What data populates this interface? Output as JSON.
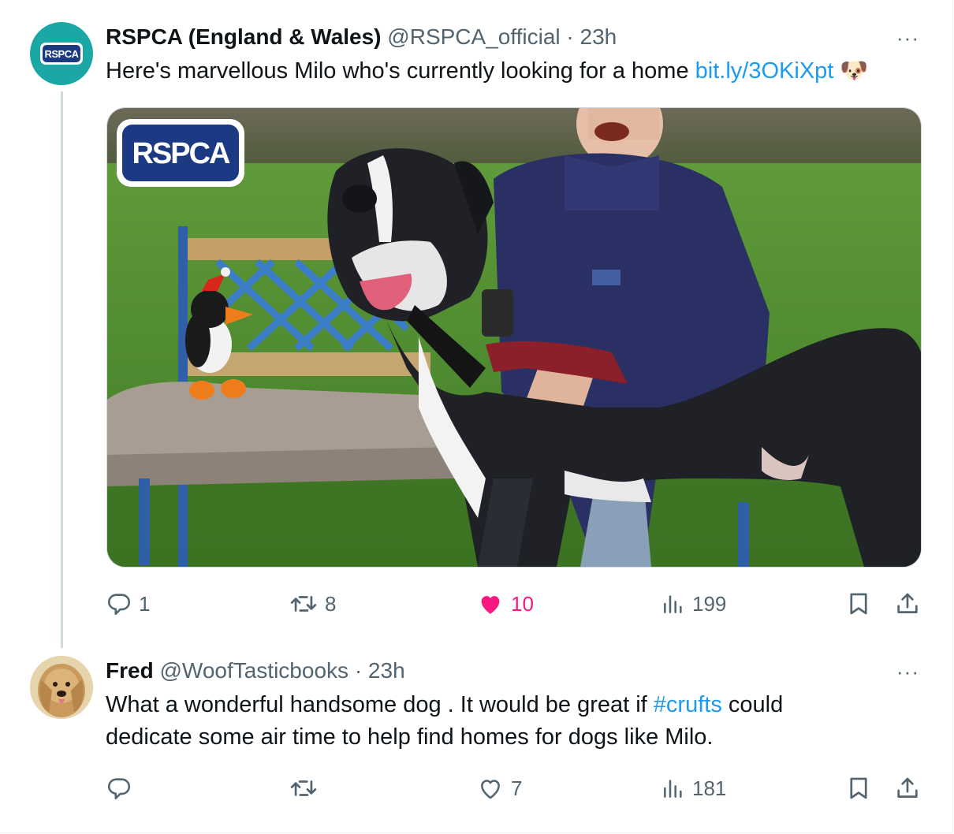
{
  "tweets": [
    {
      "author_name": "RSPCA (England & Wales)",
      "handle": "@RSPCA_official",
      "separator": "·",
      "time": "23h",
      "more": "···",
      "avatar_text": "RSPCA",
      "text_before_link": "Here's marvellous Milo who's currently looking for a home ",
      "link": "bit.ly/3OKiXpt",
      "text_after_link": " 🐶",
      "media_logo": "RSPCA",
      "replies": "1",
      "retweets": "8",
      "likes": "10",
      "views": "199",
      "liked": true
    },
    {
      "author_name": "Fred",
      "handle": "@WoofTasticbooks",
      "separator": "·",
      "time": "23h",
      "more": "···",
      "line1_before": "What a wonderful handsome dog . It would be great if ",
      "hashtag": "#crufts",
      "line1_after": " could",
      "line2": "dedicate some air time to help find homes for dogs like Milo.",
      "replies": "",
      "retweets": "",
      "likes": "7",
      "views": "181",
      "liked": false
    }
  ],
  "colors": {
    "accent_link": "#1d9bf0",
    "like_pink": "#f91880",
    "secondary_text": "#536471",
    "primary_text": "#0f1419",
    "rspca_teal": "#1aa7a5",
    "rspca_navy": "#1b3a83"
  },
  "icons": [
    "reply-icon",
    "retweet-icon",
    "like-icon",
    "views-icon",
    "bookmark-icon",
    "share-icon",
    "more-icon"
  ]
}
